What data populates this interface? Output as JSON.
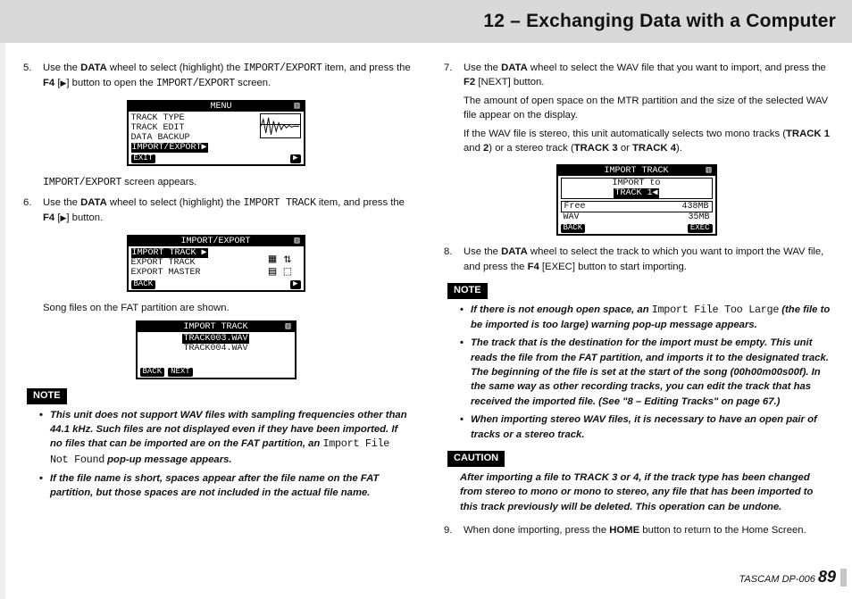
{
  "header": {
    "title": "12 – Exchanging Data with a Computer"
  },
  "footer": {
    "brand": "TASCAM  DP-006",
    "page": "89"
  },
  "labels": {
    "note": "NOTE",
    "caution": "CAUTION"
  },
  "left": {
    "step5": {
      "num": "5.",
      "line1a": "Use the ",
      "line1b": "DATA",
      "line1c": " wheel to select (highlight) the ",
      "line1d": "IMPORT/EXPORT",
      "line1e": " item, and press the ",
      "line1f": "F4",
      "line1g": " [",
      "line1h_tri": "▶",
      "line1i": "] button to open the ",
      "line1j": "IMPORT/EXPORT",
      "line1k": " screen.",
      "after_fig_a": "IMPORT/EXPORT",
      "after_fig_b": " screen appears."
    },
    "step6": {
      "num": "6.",
      "line1a": "Use the ",
      "line1b": "DATA",
      "line1c": " wheel to select (highlight) the ",
      "line1d": "IMPORT TRACK",
      "line1e": " item, and press the ",
      "line1f": "F4",
      "line1g": " [",
      "line1h_tri": "▶",
      "line1i": "] button.",
      "after_fig": "Song files on the FAT partition are shown."
    },
    "note": {
      "b1a": "This unit does not support WAV files with sampling frequencies other than 44.1 kHz. Such files are not displayed even if they have been imported. If no files that can be imported are on the FAT partition, an ",
      "b1b": "Import File Not Found",
      "b1c": " pop-up message appears.",
      "b2": "If the file name is short, spaces appear after the file name on the FAT partition, but those spaces are not included in the actual file name."
    },
    "lcd1": {
      "title": "MENU",
      "bat": "▥",
      "r1": "TRACK TYPE",
      "r2": "TRACK EDIT",
      "r3": "DATA BACKUP",
      "r4": "IMPORT/EXPORT▶",
      "foot_l": "EXIT",
      "foot_r": "▶"
    },
    "lcd2": {
      "title": "IMPORT/EXPORT",
      "bat": "▥",
      "r1": "IMPORT TRACK ▶",
      "r2": "EXPORT TRACK",
      "r3": "EXPORT MASTER",
      "foot_l": "BACK",
      "foot_r": "▶"
    },
    "lcd3": {
      "title": "IMPORT TRACK",
      "bat": "▥",
      "r1": "TRACK003.WAV",
      "r2": "TRACK004.WAV",
      "foot_l": "BACK",
      "foot_m": "NEXT"
    }
  },
  "right": {
    "step7": {
      "num": "7.",
      "p1a": "Use the ",
      "p1b": "DATA",
      "p1c": " wheel to select the WAV file that you want to import, and press the ",
      "p1d": "F2",
      "p1e": " [NEXT] button.",
      "p2": "The amount of open space on the MTR partition and the size of the selected WAV file appear on the display.",
      "p3a": "If the WAV file is stereo, this unit automatically selects two mono tracks (",
      "p3b": "TRACK 1",
      "p3c": " and ",
      "p3d": "2",
      "p3e": ") or a stereo track (",
      "p3f": "TRACK 3",
      "p3g": " or ",
      "p3h": "TRACK 4",
      "p3i": ")."
    },
    "lcd4": {
      "title": "IMPORT TRACK",
      "bat": "▥",
      "r1": "IMPORT to",
      "r2": "TRACK 1◀",
      "r3l": "Free",
      "r3r": "438MB",
      "r4l": "WAV",
      "r4r": "35MB",
      "foot_l": "BACK",
      "foot_r": "EXEC"
    },
    "step8": {
      "num": "8.",
      "p1a": "Use the ",
      "p1b": "DATA",
      "p1c": " wheel to select the track to which you want to import the WAV file, and press the ",
      "p1d": "F4",
      "p1e": " [EXEC] button to start importing."
    },
    "note": {
      "b1a": "If there is not enough open space, an ",
      "b1b": "Import File Too Large",
      "b1c": " (the file to be imported is too large) warning pop-up message appears.",
      "b2": "The track that is the destination for the import must be empty. This unit reads the file from the FAT partition, and imports it to the designated track. The beginning of the file is set at the start of the song (00h00m00s00f). In the same way as other recording tracks, you can edit the track that has received the imported file. (See \"8 – Editing Tracks\" on page 67.)",
      "b3": "When importing stereo WAV files, it is necessary to have an open pair of tracks or a stereo track."
    },
    "caution": {
      "p1a": "After importing a file to ",
      "p1b": "TRACK 3",
      "p1c": " or ",
      "p1d": "4",
      "p1e": ", if the track type has been changed from stereo to mono or mono to stereo, any file that has been imported to this track previously will be deleted. This operation can be undone."
    },
    "step9": {
      "num": "9.",
      "p1a": "When done importing, press the ",
      "p1b": "HOME",
      "p1c": " button to return to the Home Screen."
    }
  }
}
